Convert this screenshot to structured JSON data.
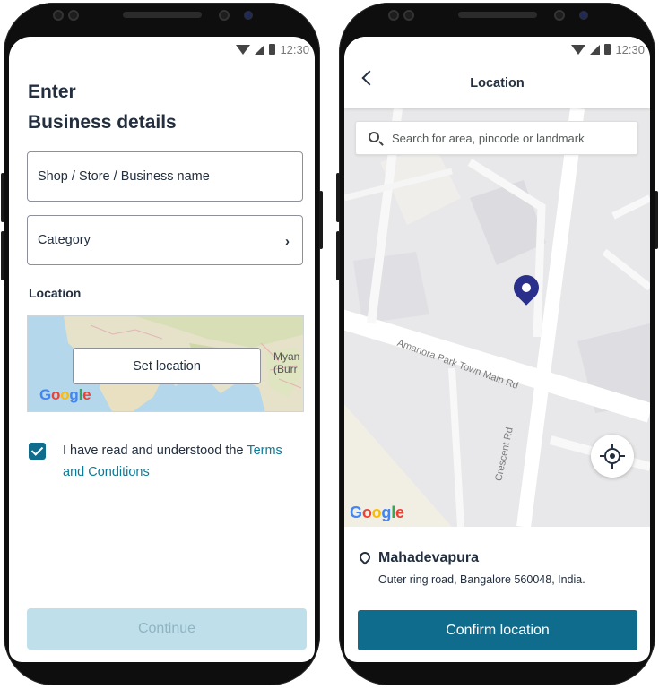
{
  "status": {
    "time": "12:30"
  },
  "details": {
    "title_line1": "Enter",
    "title_line2": "Business details",
    "name_field": "Shop / Store / Business name",
    "category_field": "Category",
    "location_label": "Location",
    "set_location": "Set location",
    "map_label_line1": "Myan",
    "map_label_line2": "(Burr",
    "terms_text": "I have read and understood the ",
    "terms_link": "Terms and Conditions",
    "terms_checked": true,
    "continue_label": "Continue",
    "continue_enabled": false
  },
  "location": {
    "title": "Location",
    "search_placeholder": "Search for area, pincode or landmark",
    "road_labels": [
      "Amanora Park Town Main Rd",
      "Crescent Rd"
    ],
    "address_title": "Mahadevapura",
    "address_sub": "Outer ring road, Bangalore 560048, India.",
    "confirm_label": "Confirm location"
  },
  "icons": [
    "wifi-icon",
    "cell-signal-icon",
    "battery-icon",
    "chevron-right-icon",
    "checkbox-checked-icon",
    "back-arrow-icon",
    "search-icon",
    "map-pin-icon",
    "my-location-icon",
    "location-outline-icon",
    "google-logo"
  ],
  "colors": {
    "primary": "#0f6c8c",
    "link": "#0a7b99",
    "disabled": "#bfe0eb",
    "pin": "#2b2f8c",
    "text": "#232f3e"
  }
}
